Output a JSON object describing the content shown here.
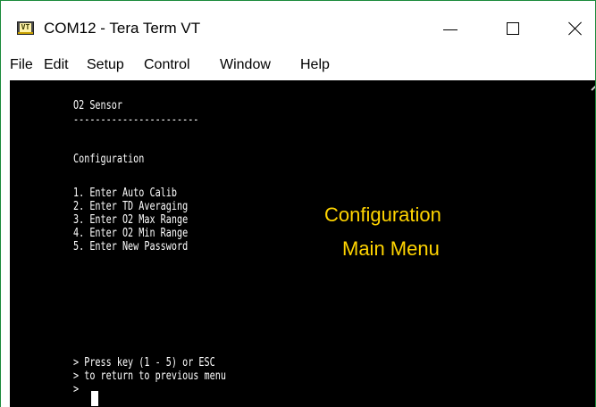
{
  "window": {
    "title": "COM12 - Tera Term VT",
    "icon": "teraterm-vt-icon",
    "icon_label": "VT",
    "controls": {
      "minimize": "minimize-icon",
      "maximize": "maximize-icon",
      "close": "close-icon"
    }
  },
  "menu": [
    "File",
    "Edit",
    "Setup",
    "Control",
    "Window",
    "Help"
  ],
  "terminal": {
    "lines": [
      "O2 Sensor",
      "-----------------------",
      "Configuration",
      "1. Enter Auto Calib",
      "2. Enter TD Averaging",
      "3. Enter O2 Max Range",
      "4. Enter O2 Min Range",
      "5. Enter New Password",
      "> Press key (1 - 5) or ESC",
      "> to return to previous menu",
      ">"
    ]
  },
  "annotation": {
    "line1": "Configuration",
    "line2": "Main Menu",
    "color": "#ffd400"
  },
  "colors": {
    "terminal_bg": "#000000",
    "terminal_fg": "#ffffff",
    "window_border": "#1a8a3a"
  }
}
